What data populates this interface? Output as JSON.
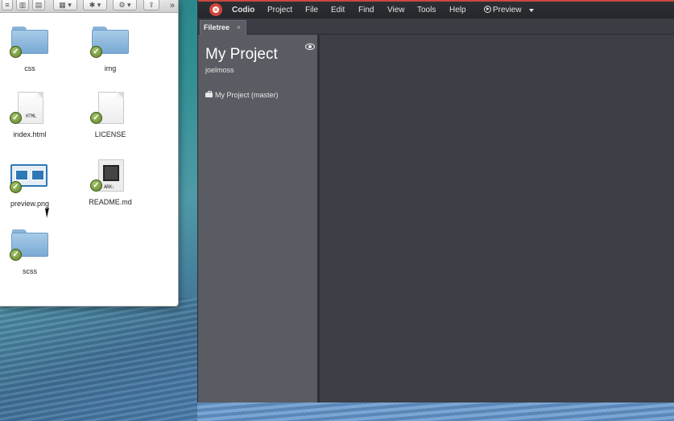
{
  "finder": {
    "toolbar": {
      "more": "»"
    },
    "items": [
      {
        "label": "css",
        "kind": "folder"
      },
      {
        "label": "img",
        "kind": "folder"
      },
      {
        "label": "index.html",
        "kind": "document",
        "tag": "HTML"
      },
      {
        "label": "LICENSE",
        "kind": "document"
      },
      {
        "label": "preview.png",
        "kind": "image"
      },
      {
        "label": "README.md",
        "kind": "markdown",
        "tag": "ARK↓"
      },
      {
        "label": "scss",
        "kind": "folder"
      }
    ]
  },
  "codio": {
    "menu": {
      "app_name": "Codio",
      "items": [
        "Project",
        "File",
        "Edit",
        "Find",
        "View",
        "Tools",
        "Help"
      ],
      "preview": "Preview"
    },
    "tabs": [
      {
        "label": "Filetree",
        "close": "×"
      }
    ],
    "filetree": {
      "title": "My Project",
      "user": "joelmoss",
      "project_entry": "My Project (master)"
    },
    "colors": {
      "accent": "#c8493f",
      "sidebar_bg": "#595c62",
      "editor_bg": "#3c3f46"
    }
  }
}
